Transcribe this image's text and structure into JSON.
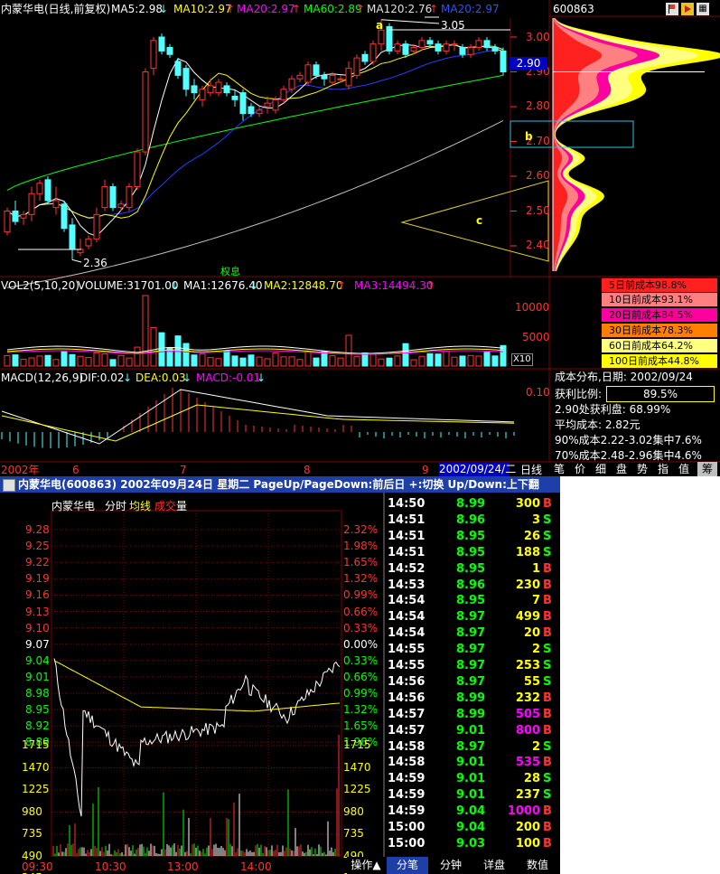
{
  "colors": {
    "bg": "#000000",
    "up": "#ff3232",
    "down": "#54ffff",
    "ma5": "#ffffff",
    "ma10": "#ffff00",
    "ma20": "#ff00ff",
    "ma60": "#00ff00",
    "ma120": "#c0c0c0",
    "ma20b": "#2040ff",
    "grid": "#800000",
    "tick_up": "#ff3232",
    "tick_down": "#00ff00"
  },
  "kline": {
    "title": "内蒙华电(日线,前复权)",
    "ma5": "MA5:2.98",
    "ma10": "MA10:2.97",
    "ma20": "MA20:2.97",
    "ma60": "MA60:2.89",
    "ma120": "MA120:2.76",
    "ma20b": "MA20:2.97",
    "price_labels": [
      "3.00",
      "2.90",
      "2.80",
      "2.70",
      "2.60",
      "2.50",
      "2.40"
    ],
    "current_price": "2.90",
    "high_mark": "3.05",
    "low_mark": "2.36",
    "exright_label": "权息",
    "label_a": "a",
    "label_b": "b",
    "label_c": "c",
    "series": {
      "closes": [
        2.5,
        2.47,
        2.49,
        2.55,
        2.58,
        2.53,
        2.53,
        2.45,
        2.39,
        2.39,
        2.42,
        2.49,
        2.57,
        2.51,
        2.52,
        2.57,
        2.67,
        2.9,
        2.99,
        2.96,
        2.95,
        2.89,
        2.85,
        2.84,
        2.85,
        2.86,
        2.87,
        2.84,
        2.82,
        2.78,
        2.78,
        2.79,
        2.81,
        2.82,
        2.85,
        2.88,
        2.89,
        2.92,
        2.89,
        2.88,
        2.89,
        2.88,
        2.91,
        2.94,
        2.93,
        2.98,
        3.02,
        2.96,
        2.98,
        2.95,
        2.97,
        2.99,
        2.98,
        2.96,
        2.98,
        2.98,
        2.95,
        2.97,
        2.99,
        2.97,
        2.96,
        2.9
      ],
      "opens": [
        2.44,
        2.5,
        2.48,
        2.49,
        2.55,
        2.59,
        2.51,
        2.52,
        2.46,
        2.38,
        2.4,
        2.42,
        2.51,
        2.57,
        2.51,
        2.51,
        2.57,
        2.67,
        2.91,
        3.0,
        2.97,
        2.93,
        2.91,
        2.86,
        2.82,
        2.84,
        2.84,
        2.86,
        2.83,
        2.84,
        2.8,
        2.78,
        2.8,
        2.79,
        2.82,
        2.85,
        2.88,
        2.87,
        2.92,
        2.89,
        2.87,
        2.88,
        2.86,
        2.89,
        2.95,
        2.93,
        2.98,
        3.03,
        2.96,
        2.98,
        2.96,
        2.97,
        2.99,
        2.98,
        2.96,
        2.98,
        2.97,
        2.95,
        2.97,
        2.99,
        2.97,
        2.96
      ],
      "highs": [
        2.51,
        2.53,
        2.5,
        2.57,
        2.59,
        2.6,
        2.57,
        2.53,
        2.48,
        2.42,
        2.43,
        2.51,
        2.59,
        2.58,
        2.53,
        2.58,
        2.68,
        2.91,
        3.0,
        3.01,
        2.98,
        2.94,
        2.92,
        2.88,
        2.86,
        2.88,
        2.88,
        2.87,
        2.85,
        2.85,
        2.81,
        2.8,
        2.83,
        2.83,
        2.86,
        2.89,
        2.9,
        2.93,
        2.93,
        2.9,
        2.9,
        2.89,
        2.93,
        2.95,
        2.96,
        2.99,
        3.05,
        3.04,
        2.99,
        2.99,
        2.98,
        3.0,
        3.0,
        2.99,
        2.99,
        2.99,
        2.98,
        2.98,
        3.0,
        3.0,
        2.98,
        2.97
      ],
      "lows": [
        2.43,
        2.46,
        2.46,
        2.47,
        2.53,
        2.52,
        2.49,
        2.44,
        2.36,
        2.37,
        2.39,
        2.41,
        2.5,
        2.5,
        2.5,
        2.5,
        2.56,
        2.66,
        2.89,
        2.95,
        2.94,
        2.88,
        2.83,
        2.82,
        2.8,
        2.83,
        2.83,
        2.83,
        2.8,
        2.76,
        2.77,
        2.77,
        2.78,
        2.78,
        2.81,
        2.84,
        2.87,
        2.86,
        2.88,
        2.86,
        2.86,
        2.87,
        2.85,
        2.88,
        2.92,
        2.92,
        2.96,
        2.95,
        2.95,
        2.94,
        2.95,
        2.96,
        2.97,
        2.95,
        2.95,
        2.96,
        2.94,
        2.94,
        2.96,
        2.96,
        2.95,
        2.89
      ]
    }
  },
  "volume": {
    "title": "VOL2(5,10,20)",
    "value": "VOLUME:31701.00",
    "ma1": "MA1:12676.40",
    "ma2": "MA2:12848.70",
    "ma3": "MA3:14494.30",
    "labels": [
      "10000",
      "5000"
    ],
    "unit": "X10"
  },
  "macd": {
    "title": "MACD(12,26,9)",
    "dif": "DIF:0.02",
    "dea": "DEA:0.03",
    "macd": "MACD:-0.01",
    "label": "0.10"
  },
  "timeaxis": {
    "labels": [
      "2002年",
      "6",
      "7",
      "8",
      "9"
    ],
    "date": "2002/09/24/二",
    "period": "日线"
  },
  "side": {
    "code": "600863",
    "dist": [
      "5日前成本98.8%",
      "10日前成本93.1%",
      "20日前成本84.5%",
      "30日前成本78.3%",
      "60日前成本64.2%",
      "100日前成本44.8%"
    ],
    "dist_colors": [
      "#ff2020",
      "#ff8080",
      "#ff00a0",
      "#ff8000",
      "#ffff80",
      "#ffff00"
    ],
    "cost_title": "成本分布,日期: 2002/09/24",
    "profit_label": "获利比例:",
    "profit_value": "89.5%",
    "profit_ratio": 0.895,
    "profit_line": "2.90处获利盘: 68.99%",
    "avg_cost": "平均成本: 2.82元",
    "conc90": "90%成本2.22-3.02集中7.6%",
    "conc70": "70%成本2.48-2.96集中4.6%",
    "tabs": [
      "笔",
      "价",
      "细",
      "盘",
      "势",
      "指",
      "值",
      "筹"
    ]
  },
  "intraday": {
    "titlebar": "内蒙华电(600863) 2002年09月24日 星期二 PageUp/PageDown:前后日 +:切换 Up/Down:上下翻",
    "name": "内蒙华电",
    "mode": "分时",
    "avg_label": "均线",
    "trade": "成交",
    "vol_word": "量",
    "prices_left": [
      "9.28",
      "9.25",
      "9.22",
      "9.19",
      "9.16",
      "9.13",
      "9.10",
      "9.07",
      "9.04",
      "9.01",
      "8.98",
      "8.95",
      "8.92",
      "8.89"
    ],
    "pcts_right": [
      "2.32%",
      "1.98%",
      "1.65%",
      "1.32%",
      "0.99%",
      "0.66%",
      "0.33%",
      "0.00%",
      "0.33%",
      "0.66%",
      "0.99%",
      "1.32%",
      "1.65%",
      "1.98%"
    ],
    "vol_labels": [
      "1715",
      "1470",
      "1225",
      "980",
      "735",
      "490",
      "245"
    ],
    "time_labels": [
      "09:30",
      "10:30",
      "13:00",
      "14:00"
    ],
    "bottom_tabs": [
      "操作▲",
      "分笔",
      "分钟",
      "详盘",
      "数值"
    ],
    "ticks": [
      {
        "time": "14:50",
        "price": "8.99",
        "vol": "300",
        "bs": "B"
      },
      {
        "time": "14:51",
        "price": "8.96",
        "vol": "3",
        "bs": "S"
      },
      {
        "time": "14:51",
        "price": "8.95",
        "vol": "26",
        "bs": "S"
      },
      {
        "time": "14:51",
        "price": "8.95",
        "vol": "188",
        "bs": "S"
      },
      {
        "time": "14:52",
        "price": "8.95",
        "vol": "1",
        "bs": "B"
      },
      {
        "time": "14:53",
        "price": "8.96",
        "vol": "230",
        "bs": "B"
      },
      {
        "time": "14:54",
        "price": "8.95",
        "vol": "7",
        "bs": "B"
      },
      {
        "time": "14:54",
        "price": "8.97",
        "vol": "499",
        "bs": "B"
      },
      {
        "time": "14:54",
        "price": "8.97",
        "vol": "20",
        "bs": "B"
      },
      {
        "time": "14:55",
        "price": "8.97",
        "vol": "2",
        "bs": "S"
      },
      {
        "time": "14:55",
        "price": "8.97",
        "vol": "253",
        "bs": "S"
      },
      {
        "time": "14:56",
        "price": "8.97",
        "vol": "55",
        "bs": "S"
      },
      {
        "time": "14:56",
        "price": "8.99",
        "vol": "232",
        "bs": "B"
      },
      {
        "time": "14:57",
        "price": "8.99",
        "vol": "505",
        "bs": "B"
      },
      {
        "time": "14:57",
        "price": "9.01",
        "vol": "800",
        "bs": "B"
      },
      {
        "time": "14:58",
        "price": "8.97",
        "vol": "2",
        "bs": "S"
      },
      {
        "time": "14:58",
        "price": "9.01",
        "vol": "535",
        "bs": "B"
      },
      {
        "time": "14:59",
        "price": "9.01",
        "vol": "28",
        "bs": "S"
      },
      {
        "time": "14:59",
        "price": "9.01",
        "vol": "237",
        "bs": "S"
      },
      {
        "time": "14:59",
        "price": "9.04",
        "vol": "1000",
        "bs": "B"
      },
      {
        "time": "15:00",
        "price": "9.04",
        "vol": "200",
        "bs": "B"
      },
      {
        "time": "15:00",
        "price": "9.03",
        "vol": "100",
        "bs": "B"
      }
    ],
    "tick_vol_colors": [
      "#ffff00",
      "#ffff00",
      "#ffff00",
      "#ffff00",
      "#ffff00",
      "#ffff00",
      "#ffff00",
      "#ffff00",
      "#ffff00",
      "#ffff00",
      "#ffff00",
      "#ffff00",
      "#ffff00",
      "#ff00ff",
      "#ff00ff",
      "#ffff00",
      "#ff00ff",
      "#ffff00",
      "#ffff00",
      "#ff00ff",
      "#ffff00",
      "#ffff00"
    ]
  }
}
